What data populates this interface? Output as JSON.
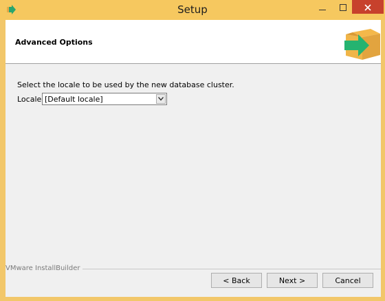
{
  "window": {
    "title": "Setup"
  },
  "header": {
    "title": "Advanced Options"
  },
  "content": {
    "description": "Select the locale to be used by the new database cluster.",
    "locale_label": "Locale",
    "locale_value": "[Default locale]"
  },
  "footer": {
    "brand": "VMware InstallBuilder",
    "back_label": "< Back",
    "next_label": "Next >",
    "cancel_label": "Cancel"
  },
  "colors": {
    "titlebar": "#f6c85f",
    "close": "#c7412c",
    "accent": "#2bb673"
  }
}
